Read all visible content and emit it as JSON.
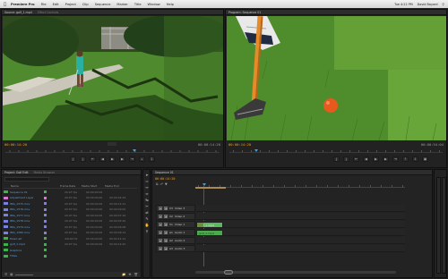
{
  "menubar": {
    "app": "Premiere Pro",
    "items": [
      "File",
      "Edit",
      "Project",
      "Clip",
      "Sequence",
      "Marker",
      "Title",
      "Window",
      "Help"
    ],
    "time": "Tue 4:22 PM",
    "user": "David Bayard"
  },
  "source": {
    "tab": "Source: golf_1.mp4",
    "tab2": "Effect Controls",
    "tc_in": "00:00:14:20",
    "tc_out": "00:00:14:20"
  },
  "program": {
    "tab": "Program: Sequence 01",
    "tc_in": "00:00:14:20",
    "tc_out": "00:00:54:04"
  },
  "project": {
    "tab": "Project: Golf Edit",
    "tab2": "Media Browser",
    "columns": [
      "Name",
      "Frame Rate",
      "Media Start",
      "Media End"
    ],
    "rows": [
      {
        "name": "Sequence 01",
        "rate": "29.97 fps",
        "start": "00:00:00:00",
        "end": "",
        "color": "#3fb24f"
      },
      {
        "name": "Adjustment Layer",
        "rate": "29.97 fps",
        "start": "00:00:00:00",
        "end": "00:00:04:29",
        "color": "#d47ad0"
      },
      {
        "name": "IMG_1575.mov",
        "rate": "29.97 fps",
        "start": "00:00:00:00",
        "end": "00:00:12:11",
        "color": "#7a82e0"
      },
      {
        "name": "IMG_1576.mov",
        "rate": "29.97 fps",
        "start": "00:00:00:00",
        "end": "00:00:09:02",
        "color": "#7a82e0"
      },
      {
        "name": "IMG_1577.mov",
        "rate": "29.97 fps",
        "start": "00:00:00:00",
        "end": "00:00:07:16",
        "color": "#7a82e0"
      },
      {
        "name": "IMG_1578.mov",
        "rate": "29.97 fps",
        "start": "00:00:00:00",
        "end": "00:00:05:20",
        "color": "#7a82e0"
      },
      {
        "name": "IMG_1579.mov",
        "rate": "29.97 fps",
        "start": "00:00:00:00",
        "end": "00:00:06:08",
        "color": "#7a82e0"
      },
      {
        "name": "IMG_1580.mov",
        "rate": "29.97 fps",
        "start": "00:00:00:00",
        "end": "00:00:08:14",
        "color": "#7a82e0"
      },
      {
        "name": "Music.aif",
        "rate": "44100 Hz",
        "start": "00:00:00:00",
        "end": "00:02:41:12",
        "color": "#3fb24f"
      },
      {
        "name": "golf_1.mp4",
        "rate": "29.97 fps",
        "start": "00:00:00:00",
        "end": "00:00:14:20",
        "color": "#3fb24f"
      },
      {
        "name": "Graphics",
        "rate": "",
        "start": "",
        "end": "",
        "color": "#3fb24f"
      },
      {
        "name": "Titles",
        "rate": "",
        "start": "",
        "end": "",
        "color": "#3fb24f"
      }
    ]
  },
  "timeline": {
    "tab": "Sequence 01",
    "tc": "00:00:14:20",
    "tracks": [
      {
        "label": "V3",
        "name": "Video 3"
      },
      {
        "label": "V2",
        "name": "Video 2"
      },
      {
        "label": "V1",
        "name": "Video 1"
      },
      {
        "label": "A1",
        "name": "Audio 1"
      },
      {
        "label": "A2",
        "name": "Audio 2"
      },
      {
        "label": "A3",
        "name": "Audio 3"
      }
    ],
    "clip_v1": "golf_1.mp4",
    "clip_a1": "golf_1.mp4"
  },
  "colors": {
    "accent": "#e3a33a",
    "playhead": "#3aa0e8",
    "video_clip": "#5cb85c",
    "audio_clip": "#4ea84e"
  }
}
